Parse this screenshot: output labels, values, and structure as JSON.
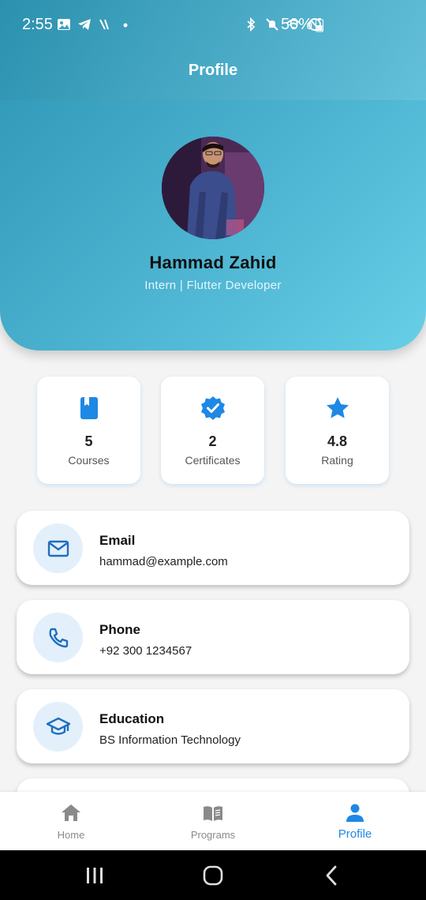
{
  "status_bar": {
    "time": "2:55",
    "battery": "50%"
  },
  "header": {
    "title": "Profile"
  },
  "profile": {
    "name": "Hammad Zahid",
    "role": "Intern | Flutter Developer"
  },
  "stats": [
    {
      "icon": "book-icon",
      "value": "5",
      "label": "Courses"
    },
    {
      "icon": "verified-badge-icon",
      "value": "2",
      "label": "Certificates"
    },
    {
      "icon": "star-icon",
      "value": "4.8",
      "label": "Rating"
    }
  ],
  "info": [
    {
      "icon": "mail-icon",
      "title": "Email",
      "value": "hammad@example.com"
    },
    {
      "icon": "phone-icon",
      "title": "Phone",
      "value": "+92 300 1234567"
    },
    {
      "icon": "graduation-cap-icon",
      "title": "Education",
      "value": "BS Information Technology"
    }
  ],
  "bottom_nav": [
    {
      "icon": "home-icon",
      "label": "Home",
      "active": false
    },
    {
      "icon": "open-book-icon",
      "label": "Programs",
      "active": false
    },
    {
      "icon": "person-icon",
      "label": "Profile",
      "active": true
    }
  ],
  "colors": {
    "accent": "#1e88e5",
    "header_start": "#2c95b3",
    "header_end": "#67cfe7",
    "icon_circle": "#e3f0fb",
    "background": "#f4f4f4"
  }
}
